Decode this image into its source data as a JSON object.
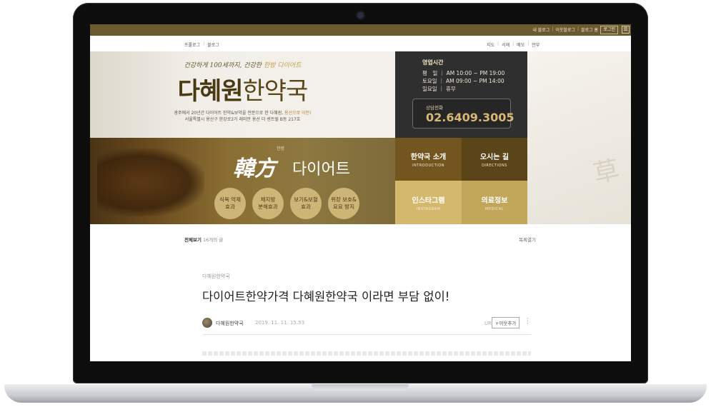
{
  "topbar": {
    "links": [
      "내 블로그",
      "이웃블로그",
      "블로그 홈"
    ],
    "login": "로그인",
    "menu_icon": "☰"
  },
  "subnav": {
    "left": [
      "프롤로그",
      "블로그"
    ],
    "right": [
      "지도",
      "서재",
      "메모",
      "안부"
    ]
  },
  "hero": {
    "tagline_pre": "건강하게 100세까지, 건강한 ",
    "tagline_hl": "한방 다이어트",
    "brand_bold": "다혜원",
    "brand_rest": "한약국",
    "desc_line1": "광주에서 20년간 다이어트 한약&보약을 전문으로 한 다혜원, ",
    "desc_line1_hl": "용산으로 이전!",
    "desc_line2": "서울특별시 용산구 한강로2가 래미안 용산 더 센트럴 B동 217호"
  },
  "hours": {
    "title": "영업시간",
    "rows": [
      "평　일 ｜ AM 10:00 ~ PM 19:00",
      "토요일 ｜ AM 09:00 ~ PM 14:00",
      "일요일 ｜ 휴무"
    ],
    "phone_label": "상담전화",
    "phone": "02.6409.3005"
  },
  "diet": {
    "title": "韓方",
    "small": "한방",
    "subtitle": "다이어트",
    "circles": [
      "식욕 억제\n효과",
      "체지방\n분해효과",
      "보기&보혈\n효과",
      "위장 보호&\n요요 방지"
    ]
  },
  "tiles": [
    {
      "title": "한약국 소개",
      "sub": "INTRODUCTION"
    },
    {
      "title": "오시는 길",
      "sub": "DIRECTIONS"
    },
    {
      "title": "인스타그램",
      "sub": "INSTAGRAM"
    },
    {
      "title": "의료정보",
      "sub": "MEDICAL"
    }
  ],
  "deco": {
    "hanja": "草"
  },
  "list": {
    "label": "전체보기",
    "count": "16개의 글",
    "toggle": "목록열기"
  },
  "post": {
    "category": "다혜원한약국",
    "title": "다이어트한약가격 다혜원한약국 이라면 부담 없이!",
    "author": "다혜원한약국",
    "date": "2019. 11. 11. 15:53",
    "url_copy": "URL 복사",
    "neighbor": "+이웃추가",
    "more": "⋮"
  },
  "colors": {
    "brand_brown": "#6b5a2f",
    "gold": "#d9b877",
    "dark_panel": "#2f2f2f"
  }
}
